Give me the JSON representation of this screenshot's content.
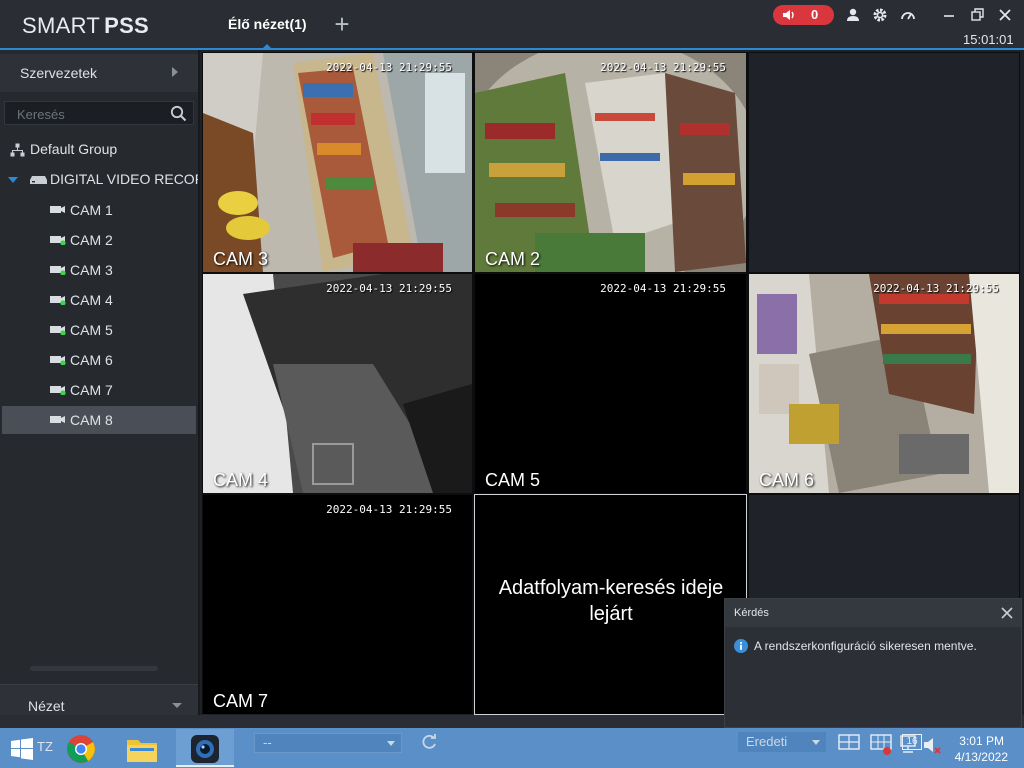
{
  "app": {
    "logo_light": "SMART",
    "logo_bold": "PSS",
    "tab_live": "Élő nézet(1)",
    "tab_add": "+",
    "alarm_count": "0",
    "clock": "15:01:01",
    "accent_color": "#2a8ad4",
    "alarm_color": "#d9363e"
  },
  "sidebar": {
    "org_header": "Szervezetek",
    "search_placeholder": "Keresés",
    "group": "Default Group",
    "device": "DIGITAL VIDEO RECORDER",
    "cameras": [
      {
        "label": "CAM 1",
        "online": false
      },
      {
        "label": "CAM 2",
        "online": true
      },
      {
        "label": "CAM 3",
        "online": true
      },
      {
        "label": "CAM 4",
        "online": true
      },
      {
        "label": "CAM 5",
        "online": true
      },
      {
        "label": "CAM 6",
        "online": true
      },
      {
        "label": "CAM 7",
        "online": true
      },
      {
        "label": "CAM 8",
        "online": false,
        "selected": true
      }
    ],
    "view_header": "Nézet"
  },
  "grid": {
    "tiles": [
      {
        "label": "CAM 3",
        "timestamp": "2022-04-13 21:29:55"
      },
      {
        "label": "CAM 2",
        "timestamp": "2022-04-13 21:29:55"
      },
      {
        "label": "",
        "timestamp": ""
      },
      {
        "label": "CAM 4",
        "timestamp": "2022-04-13 21:29:55"
      },
      {
        "label": "CAM 5",
        "timestamp": "2022-04-13 21:29:55"
      },
      {
        "label": "CAM 6",
        "timestamp": "2022-04-13 21:29:55"
      },
      {
        "label": "CAM 7",
        "timestamp": "2022-04-13 21:29:55"
      },
      {
        "label": "",
        "timestamp": "",
        "error_line1": "Adatfolyam-keresés ideje",
        "error_line2": "lejárt"
      },
      {
        "label": "",
        "timestamp": ""
      }
    ]
  },
  "toast": {
    "title": "Kérdés",
    "message": "A rendszerkonfiguráció sikeresen mentve."
  },
  "taskbar": {
    "tz_label": "TZ",
    "combo_value": "--",
    "stream_value": "Eredeti",
    "tray_badge": "16",
    "time": "3:01 PM",
    "date": "4/13/2022"
  }
}
